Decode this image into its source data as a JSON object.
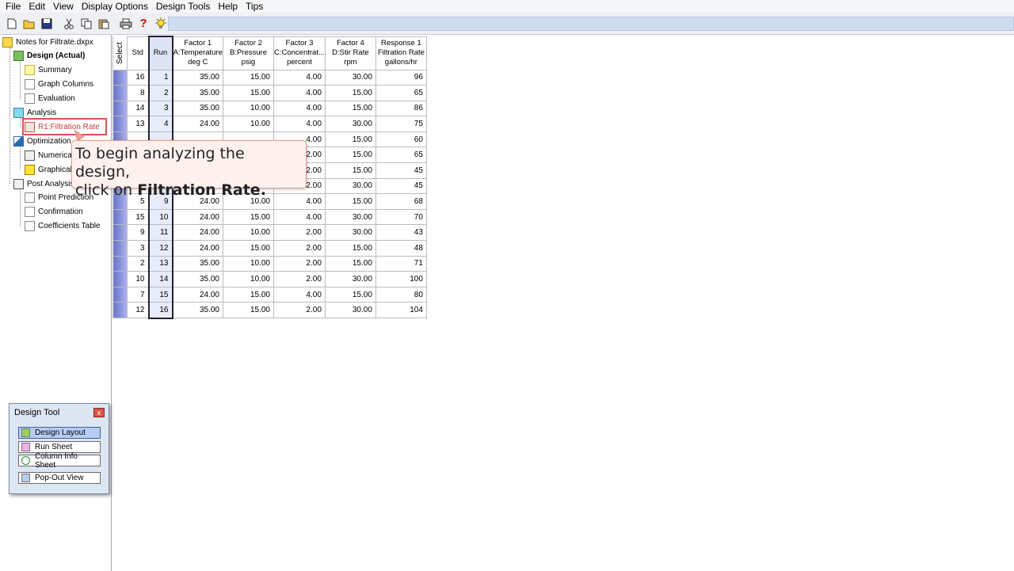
{
  "menu": [
    "File",
    "Edit",
    "View",
    "Display Options",
    "Design Tools",
    "Help",
    "Tips"
  ],
  "toolbar": {
    "icons": [
      "new-icon",
      "open-icon",
      "save-icon",
      "cut-icon",
      "copy-icon",
      "paste-icon",
      "print-icon",
      "help-icon",
      "tip-icon"
    ],
    "help_glyph": "?"
  },
  "tree": {
    "root": "Notes for Filtrate.dxpx",
    "design": "Design (Actual)",
    "summary": "Summary",
    "graph_columns": "Graph Columns",
    "evaluation": "Evaluation",
    "analysis": "Analysis",
    "r1": "R1:Filtration Rate",
    "optimization": "Optimization",
    "numerical": "Numerica",
    "graphical": "Graphical",
    "post_analysis": "Post Analysis",
    "point_prediction": "Point Prediction",
    "confirmation": "Confirmation",
    "coefficients": "Coefficients Table"
  },
  "grid": {
    "headers": {
      "select": "Select",
      "std": "Std",
      "run": "Run",
      "a": [
        "Factor 1",
        "A:Temperature",
        "deg C"
      ],
      "b": [
        "Factor 2",
        "B:Pressure",
        "psig"
      ],
      "c": [
        "Factor 3",
        "C:Concentrat...",
        "percent"
      ],
      "d": [
        "Factor 4",
        "D:Stir Rate",
        "rpm"
      ],
      "r": [
        "Response 1",
        "Filtration Rate",
        "gallons/hr"
      ]
    },
    "rows": [
      [
        "16",
        "1",
        "35.00",
        "15.00",
        "4.00",
        "30.00",
        "96"
      ],
      [
        "8",
        "2",
        "35.00",
        "15.00",
        "4.00",
        "15.00",
        "65"
      ],
      [
        "14",
        "3",
        "35.00",
        "10.00",
        "4.00",
        "15.00",
        "86"
      ],
      [
        "13",
        "4",
        "24.00",
        "10.00",
        "4.00",
        "30.00",
        "75"
      ],
      [
        "",
        "",
        "",
        "",
        "4.00",
        "15.00",
        "60"
      ],
      [
        "",
        "",
        "",
        "",
        "2.00",
        "15.00",
        "65"
      ],
      [
        "",
        "",
        "",
        "",
        "2.00",
        "15.00",
        "45"
      ],
      [
        "",
        "",
        "",
        "",
        "2.00",
        "30.00",
        "45"
      ],
      [
        "5",
        "9",
        "24.00",
        "10.00",
        "4.00",
        "15.00",
        "68"
      ],
      [
        "15",
        "10",
        "24.00",
        "15.00",
        "4.00",
        "30.00",
        "70"
      ],
      [
        "9",
        "11",
        "24.00",
        "10.00",
        "2.00",
        "30.00",
        "43"
      ],
      [
        "3",
        "12",
        "24.00",
        "15.00",
        "2.00",
        "15.00",
        "48"
      ],
      [
        "2",
        "13",
        "35.00",
        "10.00",
        "2.00",
        "15.00",
        "71"
      ],
      [
        "10",
        "14",
        "35.00",
        "10.00",
        "2.00",
        "30.00",
        "100"
      ],
      [
        "7",
        "15",
        "24.00",
        "15.00",
        "4.00",
        "15.00",
        "80"
      ],
      [
        "12",
        "16",
        "35.00",
        "15.00",
        "2.00",
        "30.00",
        "104"
      ]
    ]
  },
  "callout": {
    "line1": "To begin analyzing the design,",
    "line2_pre": "click on ",
    "line2_bold": "Filtration Rate."
  },
  "design_tool": {
    "title": "Design Tool",
    "close_glyph": "x",
    "buttons": [
      "Design Layout",
      "Run Sheet",
      "Column Info Sheet",
      "Pop-Out View"
    ]
  }
}
